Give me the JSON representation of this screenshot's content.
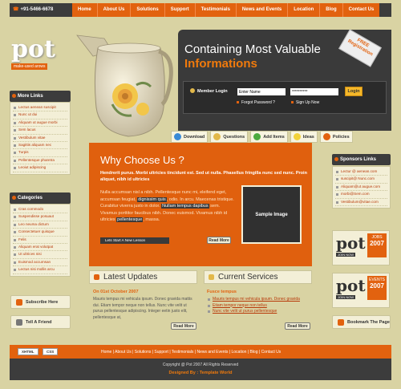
{
  "header": {
    "phone": "+91-5466-6678",
    "nav": [
      "Home",
      "About Us",
      "Solutions",
      "Support",
      "Testimonials",
      "News and Events",
      "Location",
      "Blog",
      "Contact Us"
    ],
    "logo": "pot",
    "logo_tagline": "make-used arows",
    "headline_1": "Containing Most Valuable",
    "headline_2": "Informations",
    "badge": "FREE Registration",
    "login": {
      "label": "Member Login",
      "username_value": "Enter Name",
      "password_value": "**********",
      "button": "Login",
      "forgot": "Forgot Password ?",
      "signup": "Sign Up Now"
    },
    "toolbar": [
      {
        "label": "Download",
        "icon": "download-icon",
        "color": "#3a8ad6"
      },
      {
        "label": "Questions",
        "icon": "question-icon",
        "color": "#e2b84a"
      },
      {
        "label": "Add Items",
        "icon": "add-icon",
        "color": "#4caa3e"
      },
      {
        "label": "Ideas",
        "icon": "lightbulb-icon",
        "color": "#f2d23a"
      },
      {
        "label": "Policies",
        "icon": "document-icon",
        "color": "#e2620f"
      }
    ]
  },
  "left_sidebar": {
    "more_links": {
      "title": "More Links",
      "items": [
        "Lectus aenean suscipit",
        "Nunc ut dui",
        "Aliquam ut augue morbi",
        "Sem lacus",
        "Vestibulum vitae",
        "Sagittis aliquam nec",
        "Turpis",
        "Pellentesque pharetra",
        "Leoiut adipiscing"
      ]
    },
    "categories": {
      "title": "Categories",
      "items": [
        "Cras commodo",
        "Suspendisse posuaut",
        "Leo neuma dictum",
        "Consectetuer quisque",
        "Felis",
        "Aliquam erat volutpat",
        "Ut ultrices nisi",
        "Euismod accumsan",
        "Lectus nisi mollis arcu"
      ]
    },
    "subscribe": "Subscribe Here",
    "tell_friend": "Tell A Friend"
  },
  "main": {
    "why_title": "Why Choose Us ?",
    "why_bold": "Hendrerit purus. Morbi ultricies tincidunt est. Sed ut nulla. Phasellus fringilla nunc sed nunc. Proin aliquet, nibh id ultricies",
    "why_text_1": "Nulla accumsan nisl a nibh. Pellentesque nunc mi, eleifend eget, accumsan feugiat, ",
    "why_text_hl_1": "dignissim quis",
    "why_text_2": ", odio. In arcu. Maecenas tristique. Curabitur viverra justo in dolor. ",
    "why_text_hl_2": "Nullam tempus dapibus",
    "why_text_3": " sem. Vivamus porttitor faucibus nibh. Donec euismod. Vivamus nibh id ultricies ",
    "why_text_hl_3": "pellentesque",
    "why_text_4": ", massa.",
    "sample_image": "Sample Image",
    "new_lesson": "Lets Start A New Lesson",
    "read_more": "Read More",
    "updates": {
      "title": "Latest Updates",
      "date": "On 01st October 2007",
      "text": "Mauris tempus mi vehicula ipsum. Donec gravida mattis dui. Etiam tempor neque non tellus. Nunc vite velit ut purus pellentesque adipiscing. Integer eetin justo elit, pellentesque at,",
      "read_more": "Read More"
    },
    "services": {
      "title": "Current Services",
      "subtitle": "Fusce tempus",
      "items": [
        "Mauris tempus mi vehicula ipsum. Donec gravida",
        "Etiam tempor neque non tellus",
        "Nunc vite velit ut purus pellentesque"
      ],
      "read_more": "Read More"
    }
  },
  "right_sidebar": {
    "sponsors_title": "Sponsors Links",
    "sponsors": [
      "Lectur @ aenean.com",
      "suscipit@ Nunc.com",
      "Aliquam@ut augue.com",
      "morbi@Sem.com",
      "Vestibulum@vitae.com"
    ],
    "ad1": {
      "logo": "pot",
      "label": "JOBS",
      "year": "2007",
      "join": "JOIN NOW"
    },
    "ad2": {
      "logo": "pot",
      "label": "EVENTS",
      "year": "2007",
      "join": "JOIN NOW"
    },
    "bookmark": "Bookmark The Page"
  },
  "footer": {
    "xhtml": "XHTML",
    "css": "CSS",
    "nav": "Home  |  About Us  |  Solutions  |  Support  |  Testimonials  |  News and Events  |  Location  |  Blog  |  Contact Us",
    "copyright": "Copyright @ Pot 2007 All Rights Reserved",
    "designed": "Designed By : Template World"
  }
}
